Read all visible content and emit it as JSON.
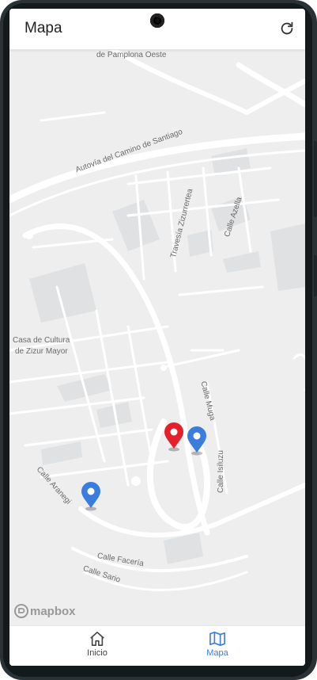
{
  "app": {
    "title": "Mapa"
  },
  "map": {
    "street_labels": {
      "pamplona": "de Pamplona Oeste",
      "camino_santiago": "Autovía del Camino de Santiago",
      "travesia": "Travesía Zizurrertea",
      "azella": "Calle Azella",
      "casa_cultura_1": "Casa de Cultura",
      "casa_cultura_2": "de Zizur Mayor",
      "muga": "Calle Muga",
      "isiluzu": "Calle Isiluzu",
      "aranegi": "Calle Aranegi",
      "faceria": "Calle Facería",
      "sario": "Calle Sario"
    },
    "attribution": "mapbox",
    "markers": [
      {
        "color": "#e5202a"
      },
      {
        "color": "#3b7ddd"
      },
      {
        "color": "#3b7ddd"
      }
    ]
  },
  "bottom_nav": {
    "items": [
      {
        "label": "Inicio",
        "icon": "home-icon",
        "active": false
      },
      {
        "label": "Mapa",
        "icon": "map-icon",
        "active": true
      }
    ]
  },
  "colors": {
    "accent": "#3b7ddd",
    "marker_red": "#e5202a"
  }
}
